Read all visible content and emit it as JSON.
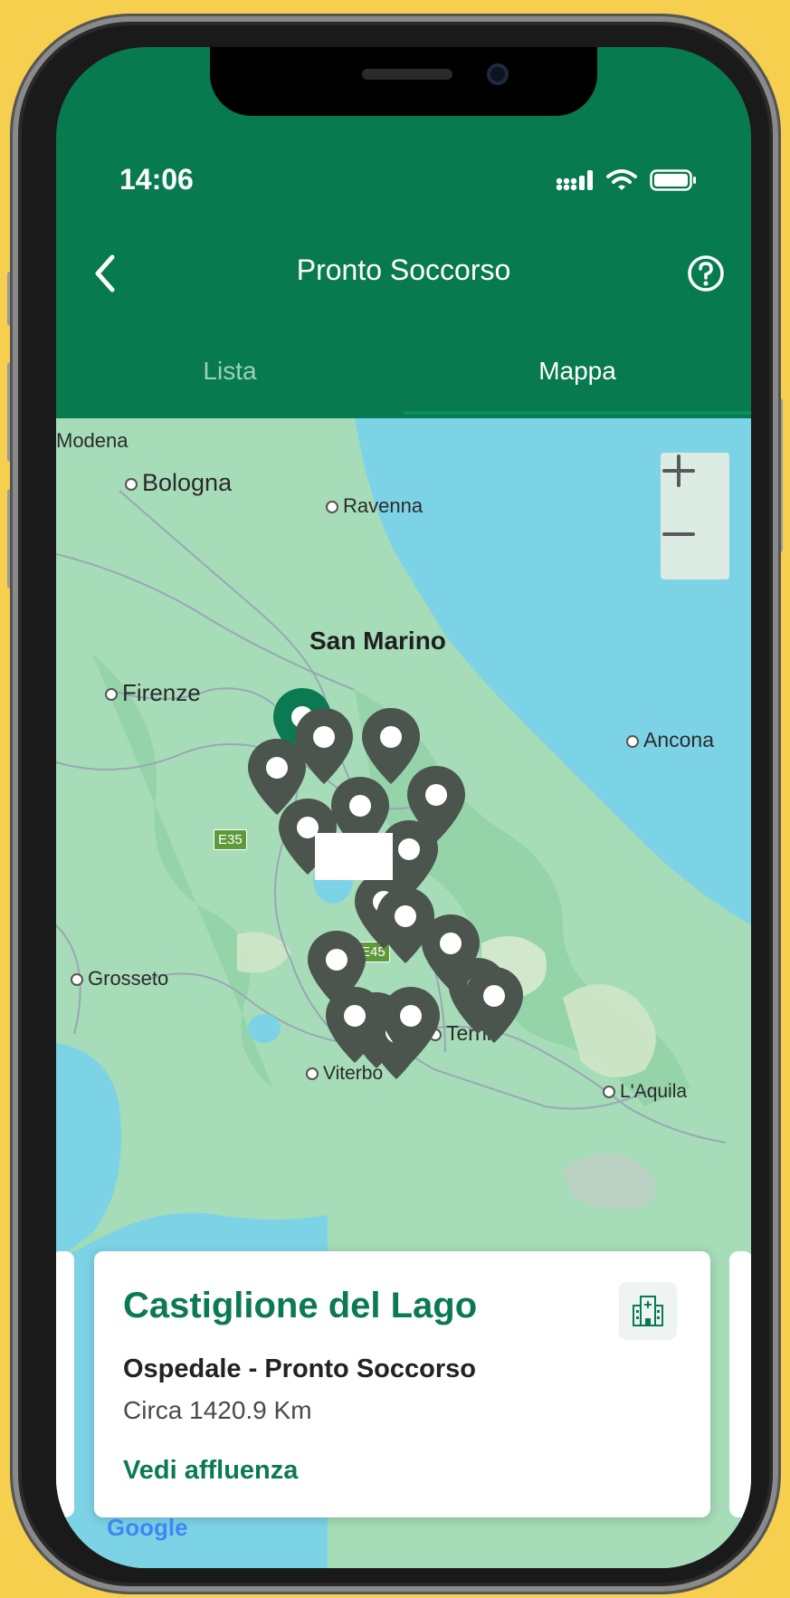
{
  "status_bar": {
    "time": "14:06"
  },
  "header": {
    "title": "Pronto Soccorso"
  },
  "tabs": [
    {
      "label": "Lista",
      "active": false
    },
    {
      "label": "Mappa",
      "active": true
    }
  ],
  "map": {
    "labels": {
      "modena": "Modena",
      "bologna": "Bologna",
      "ravenna": "Ravenna",
      "san_marino": "San Marino",
      "firenze": "Firenze",
      "ancona": "Ancona",
      "grosseto": "Grosseto",
      "terni": "Terni",
      "viterbo": "Viterbo",
      "laquila": "L'Aquila"
    },
    "roads": {
      "e35": "E35",
      "e45": "E45"
    },
    "zoom": {
      "in": "+",
      "out": "−"
    },
    "attribution": "Google"
  },
  "card": {
    "title": "Castiglione del Lago",
    "subtitle": "Ospedale - Pronto Soccorso",
    "distance": "Circa 1420.9 Km",
    "link": "Vedi affluenza"
  },
  "colors": {
    "brand_green": "#087a4f",
    "pin_dark": "#4b544d",
    "pin_selected": "#0b7a52",
    "background": "#f6cf4e"
  }
}
